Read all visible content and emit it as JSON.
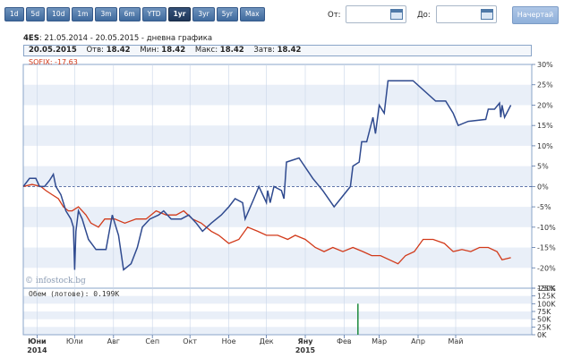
{
  "toolbar": {
    "range_buttons": [
      "1d",
      "5d",
      "10d",
      "1m",
      "3m",
      "6m",
      "YTD",
      "1yr",
      "3yr",
      "5yr",
      "Max"
    ],
    "active_range": "1yr",
    "from_label": "От:",
    "to_label": "До:",
    "from_value": "",
    "to_value": "",
    "go_label": "Начертай"
  },
  "header": {
    "symbol": "4ES",
    "period": "21.05.2014 - 20.05.2015 - дневна графика",
    "quote_date": "20.05.2015",
    "open_label": "Отв:",
    "open_value": "18.42",
    "low_label": "Мин:",
    "low_value": "18.42",
    "high_label": "Макс:",
    "high_value": "18.42",
    "close_label": "Затв:",
    "close_value": "18.42"
  },
  "legend": {
    "sofix_label": "SOFIX: -17.63",
    "volume_label": "Обем (лотове): 0.199K",
    "watermark": "© infostock.bg"
  },
  "colors": {
    "series_4es": "#2f4a8f",
    "series_sofix": "#d23a1a",
    "volume_bar": "#1c8a3c",
    "band": "#e9eff8",
    "axis": "#5a78a8"
  },
  "chart_data": [
    {
      "type": "line",
      "title": "",
      "xlabel": "",
      "ylabel": "",
      "x_axis": {
        "range": [
          "2014-05-21",
          "2015-05-20"
        ],
        "ticks": [
          {
            "label": "Юни",
            "date": "2014-06-01"
          },
          {
            "label": "Юли",
            "date": "2014-07-01"
          },
          {
            "label": "Авг",
            "date": "2014-08-01"
          },
          {
            "label": "Сеп",
            "date": "2014-09-01"
          },
          {
            "label": "Окт",
            "date": "2014-10-01"
          },
          {
            "label": "Ное",
            "date": "2014-11-01"
          },
          {
            "label": "Дек",
            "date": "2014-12-01"
          },
          {
            "label": "Яну",
            "date": "2015-01-01"
          },
          {
            "label": "Фев",
            "date": "2015-02-01"
          },
          {
            "label": "Мар",
            "date": "2015-03-01"
          },
          {
            "label": "Апр",
            "date": "2015-04-01"
          },
          {
            "label": "Май",
            "date": "2015-05-01"
          }
        ],
        "year_labels": [
          {
            "label": "2014",
            "date": "2014-06-01"
          },
          {
            "label": "2015",
            "date": "2015-01-01"
          }
        ]
      },
      "y_axis": {
        "range": [
          -25,
          30
        ],
        "ticks": [
          "30%",
          "25%",
          "20%",
          "15%",
          "10%",
          "5%",
          "0%",
          "-5%",
          "-10%",
          "-15%",
          "-20%",
          "-25%"
        ]
      },
      "grid": true,
      "zero_line": "dashed",
      "series": [
        {
          "name": "4ES",
          "points": [
            [
              "2014-05-21",
              0
            ],
            [
              "2014-05-26",
              2
            ],
            [
              "2014-05-31",
              2
            ],
            [
              "2014-06-03",
              0
            ],
            [
              "2014-06-07",
              0
            ],
            [
              "2014-06-11",
              1.5
            ],
            [
              "2014-06-14",
              3
            ],
            [
              "2014-06-16",
              0
            ],
            [
              "2014-06-20",
              -2
            ],
            [
              "2014-06-24",
              -6
            ],
            [
              "2014-06-28",
              -8
            ],
            [
              "2014-06-30",
              -10
            ],
            [
              "2014-07-01",
              -20.5
            ],
            [
              "2014-07-02",
              -11
            ],
            [
              "2014-07-04",
              -6
            ],
            [
              "2014-07-07",
              -8
            ],
            [
              "2014-07-12",
              -13
            ],
            [
              "2014-07-18",
              -15.5
            ],
            [
              "2014-07-26",
              -15.5
            ],
            [
              "2014-07-31",
              -7
            ],
            [
              "2014-08-05",
              -12
            ],
            [
              "2014-08-09",
              -20.5
            ],
            [
              "2014-08-15",
              -19
            ],
            [
              "2014-08-20",
              -15
            ],
            [
              "2014-08-24",
              -10
            ],
            [
              "2014-08-30",
              -8
            ],
            [
              "2014-09-06",
              -7
            ],
            [
              "2014-09-10",
              -6
            ],
            [
              "2014-09-16",
              -8
            ],
            [
              "2014-09-24",
              -8
            ],
            [
              "2014-09-30",
              -7
            ],
            [
              "2014-10-06",
              -9
            ],
            [
              "2014-10-11",
              -11
            ],
            [
              "2014-10-18",
              -9
            ],
            [
              "2014-10-26",
              -7
            ],
            [
              "2014-11-01",
              -5
            ],
            [
              "2014-11-06",
              -3
            ],
            [
              "2014-11-12",
              -4
            ],
            [
              "2014-11-14",
              -8
            ],
            [
              "2014-11-21",
              -3
            ],
            [
              "2014-11-25",
              0
            ],
            [
              "2014-12-01",
              -4
            ],
            [
              "2014-12-02",
              -1
            ],
            [
              "2014-12-04",
              -4
            ],
            [
              "2014-12-07",
              0
            ],
            [
              "2014-12-13",
              -1
            ],
            [
              "2014-12-15",
              -3
            ],
            [
              "2014-12-17",
              6
            ],
            [
              "2014-12-27",
              7
            ],
            [
              "2015-01-07",
              2
            ],
            [
              "2015-01-15",
              -1
            ],
            [
              "2015-01-24",
              -5
            ],
            [
              "2015-02-06",
              0
            ],
            [
              "2015-02-08",
              5
            ],
            [
              "2015-02-13",
              6
            ],
            [
              "2015-02-15",
              11
            ],
            [
              "2015-02-19",
              11
            ],
            [
              "2015-02-24",
              17
            ],
            [
              "2015-02-26",
              13
            ],
            [
              "2015-03-01",
              20
            ],
            [
              "2015-03-05",
              18
            ],
            [
              "2015-03-08",
              26
            ],
            [
              "2015-03-28",
              26
            ],
            [
              "2015-04-15",
              21
            ],
            [
              "2015-04-23",
              21
            ],
            [
              "2015-04-29",
              18
            ],
            [
              "2015-05-03",
              15
            ],
            [
              "2015-05-11",
              16
            ],
            [
              "2015-05-25",
              16.5
            ],
            [
              "2015-05-27",
              19
            ],
            [
              "2015-06-01",
              19
            ],
            [
              "2015-06-05",
              20.5
            ],
            [
              "2015-06-06",
              17
            ],
            [
              "2015-06-07",
              20
            ],
            [
              "2015-06-09",
              17
            ],
            [
              "2015-06-14",
              20
            ]
          ]
        },
        {
          "name": "SOFIX",
          "points": [
            [
              "2014-05-21",
              0
            ],
            [
              "2014-05-28",
              0.5
            ],
            [
              "2014-06-04",
              0
            ],
            [
              "2014-06-08",
              -1
            ],
            [
              "2014-06-13",
              -2
            ],
            [
              "2014-06-18",
              -3
            ],
            [
              "2014-06-22",
              -5
            ],
            [
              "2014-06-26",
              -6
            ],
            [
              "2014-06-29",
              -6
            ],
            [
              "2014-07-04",
              -5
            ],
            [
              "2014-07-10",
              -7
            ],
            [
              "2014-07-14",
              -9
            ],
            [
              "2014-07-20",
              -10
            ],
            [
              "2014-07-25",
              -8
            ],
            [
              "2014-08-02",
              -8
            ],
            [
              "2014-08-10",
              -9
            ],
            [
              "2014-08-19",
              -8
            ],
            [
              "2014-08-27",
              -8
            ],
            [
              "2014-09-04",
              -6
            ],
            [
              "2014-09-12",
              -7
            ],
            [
              "2014-09-20",
              -7
            ],
            [
              "2014-09-26",
              -6
            ],
            [
              "2014-10-03",
              -8
            ],
            [
              "2014-10-10",
              -9
            ],
            [
              "2014-10-18",
              -11
            ],
            [
              "2014-10-24",
              -12
            ],
            [
              "2014-11-01",
              -14
            ],
            [
              "2014-11-09",
              -13
            ],
            [
              "2014-11-16",
              -10
            ],
            [
              "2014-11-24",
              -11
            ],
            [
              "2014-12-01",
              -12
            ],
            [
              "2014-12-10",
              -12
            ],
            [
              "2014-12-18",
              -13
            ],
            [
              "2014-12-24",
              -12
            ],
            [
              "2015-01-01",
              -13
            ],
            [
              "2015-01-09",
              -15
            ],
            [
              "2015-01-16",
              -16
            ],
            [
              "2015-01-23",
              -15
            ],
            [
              "2015-01-31",
              -16
            ],
            [
              "2015-02-08",
              -15
            ],
            [
              "2015-02-16",
              -16
            ],
            [
              "2015-02-23",
              -17
            ],
            [
              "2015-03-02",
              -17
            ],
            [
              "2015-03-09",
              -18
            ],
            [
              "2015-03-16",
              -19
            ],
            [
              "2015-03-22",
              -17
            ],
            [
              "2015-03-29",
              -16
            ],
            [
              "2015-04-05",
              -13
            ],
            [
              "2015-04-13",
              -13
            ],
            [
              "2015-04-22",
              -14
            ],
            [
              "2015-04-29",
              -16
            ],
            [
              "2015-05-06",
              -15.5
            ],
            [
              "2015-05-13",
              -16
            ],
            [
              "2015-05-20",
              -15
            ],
            [
              "2015-05-27",
              -15
            ],
            [
              "2015-06-03",
              -16
            ],
            [
              "2015-06-07",
              -18
            ],
            [
              "2015-06-14",
              -17.5
            ]
          ]
        }
      ]
    },
    {
      "type": "bar",
      "title": "",
      "ylabel": "",
      "y_axis": {
        "range": [
          0,
          150000
        ],
        "ticks": [
          "150K",
          "125K",
          "100K",
          "75K",
          "50K",
          "25K",
          "0K"
        ]
      },
      "bars": [
        {
          "date": "2015-02-12",
          "value": 100000
        }
      ]
    }
  ]
}
